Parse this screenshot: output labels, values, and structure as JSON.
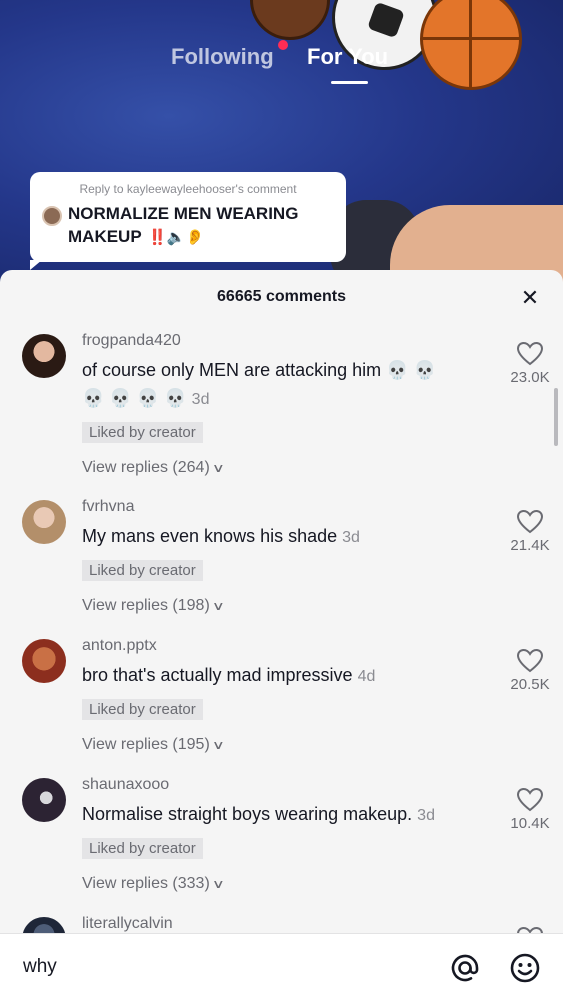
{
  "nav": {
    "tabs": [
      {
        "label": "Following",
        "active": false,
        "has_notification_dot": true
      },
      {
        "label": "For You",
        "active": true
      }
    ]
  },
  "reply_card": {
    "header": "Reply to kayleewayleehooser's comment",
    "text": "NORMALIZE MEN WEARING MAKEUP",
    "emojis": "‼️🔈👂"
  },
  "comments_panel": {
    "count_label": "66665 comments",
    "close_icon": "close-icon",
    "comments": [
      {
        "username": "frogpanda420",
        "text": "of course only MEN are attacking him 💀 💀",
        "text_line2": "💀 💀 💀 💀",
        "time": "3d",
        "badge": "Liked by creator",
        "view_replies": "View replies (264)",
        "likes": "23.0K"
      },
      {
        "username": "fvrhvna",
        "text": "My mans even knows his shade",
        "time": "3d",
        "badge": "Liked by creator",
        "view_replies": "View replies (198)",
        "likes": "21.4K"
      },
      {
        "username": "anton.pptx",
        "text": "bro that's actually mad impressive",
        "time": "4d",
        "badge": "Liked by creator",
        "view_replies": "View replies (195)",
        "likes": "20.5K"
      },
      {
        "username": "shaunaxooo",
        "text": "Normalise straight boys wearing makeup.",
        "time": "3d",
        "badge": "Liked by creator",
        "view_replies": "View replies (333)",
        "likes": "10.4K"
      },
      {
        "username": "literallycalvin"
      }
    ]
  },
  "input": {
    "value": "why",
    "mention_icon": "at-mention-icon",
    "emoji_icon": "emoji-icon"
  },
  "colors": {
    "accent": "#fe2c55",
    "sheet_bg": "#f5f5f5",
    "text_primary": "#161823",
    "text_secondary": "#6a6b72"
  }
}
